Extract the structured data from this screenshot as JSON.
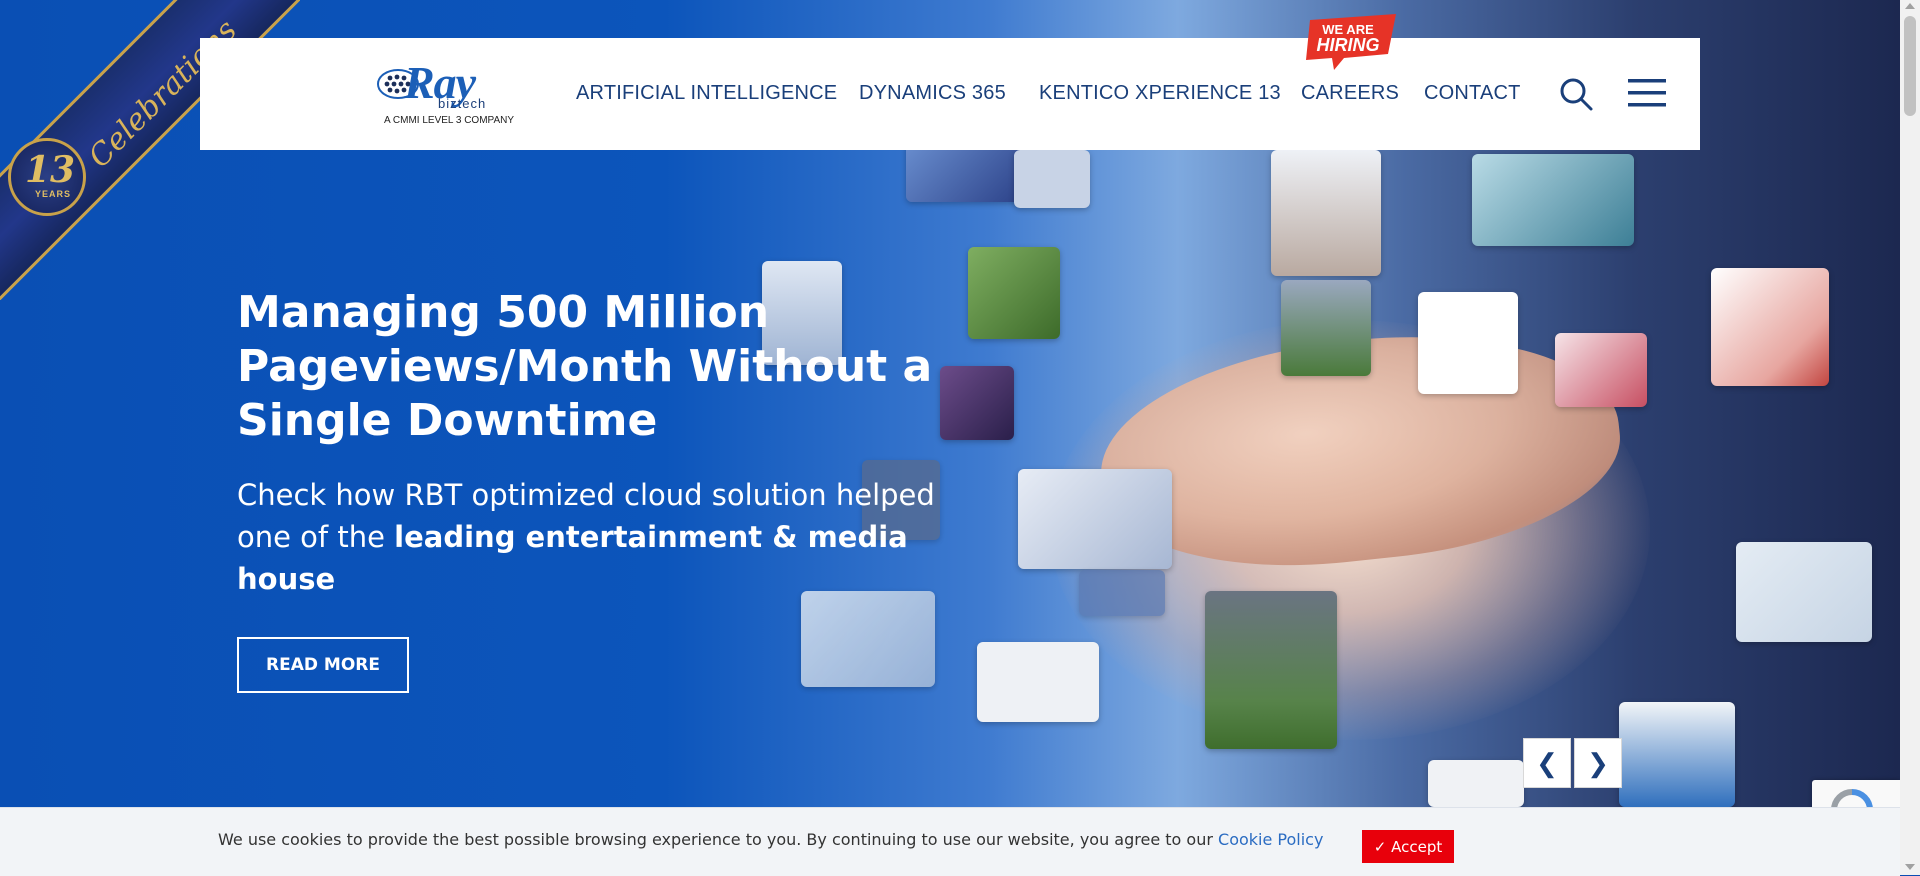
{
  "ribbon": {
    "text": "Celebrations",
    "badge_number": "13",
    "badge_label": "YEARS"
  },
  "logo": {
    "name": "Ray",
    "sub_brand": "biztech",
    "tagline": "A CMMI LEVEL 3 COMPANY"
  },
  "nav": {
    "items": [
      {
        "label": "ARTIFICIAL INTELLIGENCE"
      },
      {
        "label": "DYNAMICS 365"
      },
      {
        "label": "KENTICO XPERIENCE 13"
      },
      {
        "label": "CAREERS"
      },
      {
        "label": "CONTACT"
      }
    ],
    "hiring_badge": {
      "line1": "WE ARE",
      "line2": "HIRING"
    },
    "icons": {
      "search": "search-icon",
      "menu": "hamburger-menu-icon"
    }
  },
  "hero": {
    "headline": "Managing 500 Million Pageviews/Month Without a Single Downtime",
    "subtext_plain": "Check how RBT optimized cloud solution helped one of the ",
    "subtext_bold": "leading entertainment & media house",
    "cta": "READ MORE",
    "prev_arrow": "❮",
    "next_arrow": "❯"
  },
  "cookie": {
    "message": "We use cookies to provide the best possible browsing experience to you. By continuing to use our website, you agree to our ",
    "link": "Cookie Policy",
    "accept": "✓ Accept"
  },
  "colors": {
    "brand_blue": "#0b4db3",
    "nav_text": "#1a3f7a",
    "accept_red": "#e8000b",
    "hiring_red": "#e63327"
  }
}
